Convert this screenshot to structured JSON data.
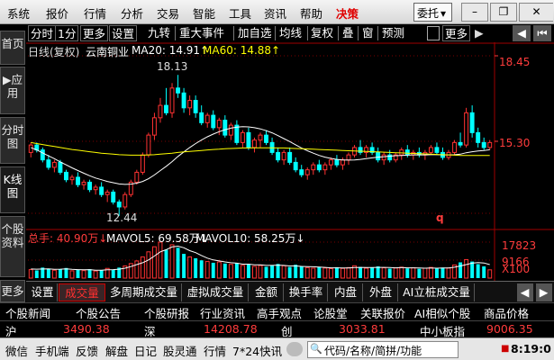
{
  "menu": {
    "items": [
      "系统",
      "报价",
      "行情",
      "分析",
      "交易",
      "智能",
      "工具",
      "资讯",
      "帮助",
      "决策"
    ],
    "active_index": 9,
    "trade_button": "委托",
    "trade_caret": "▾"
  },
  "window_controls": {
    "minimize": "–",
    "restore": "❐",
    "close": "✕"
  },
  "left_tabs": [
    {
      "label": "首页"
    },
    {
      "label": "▶应用"
    },
    {
      "label": "分时图"
    },
    {
      "label": "K线图",
      "active": true
    },
    {
      "label": "个股资料"
    },
    {
      "label": "更多"
    }
  ],
  "toolbar": {
    "items": [
      "分时",
      "1分",
      "更多",
      "设置",
      "九转",
      "重大事件",
      "加自选",
      "均线",
      "复权",
      "叠",
      "窗",
      "预测"
    ],
    "more": "更多",
    "caret": "▶",
    "prev": "◀",
    "skip": "⏮"
  },
  "chart_header": {
    "period": "日线(复权)",
    "name": "云南铜业",
    "ma20_label": "MA20: 14.91",
    "ma60_label": "MA60: 14.88",
    "ma20_arrow": "↑",
    "ma60_arrow": "↑"
  },
  "price_axis": {
    "top": "18.45",
    "mid": "15.30"
  },
  "annotations": {
    "high": "18.13",
    "low": "12.44",
    "marker": "q"
  },
  "volume_header": {
    "total": "总手: 40.90万",
    "total_arrow": "↓",
    "mavol5": "MAVOL5: 69.58万",
    "mavol5_arrow": "↓",
    "mavol10": "MAVOL10: 58.25万",
    "mavol10_arrow": "↓"
  },
  "volume_axis": {
    "top": "17823",
    "mid": "9166",
    "unit": "X100"
  },
  "chart_data": {
    "type": "candlestick",
    "ylim": [
      12.0,
      18.9
    ],
    "candles": [
      [
        15.0,
        15.4,
        14.8,
        15.3
      ],
      [
        15.3,
        15.4,
        15.0,
        15.1
      ],
      [
        15.1,
        15.2,
        14.6,
        14.7
      ],
      [
        14.7,
        14.9,
        14.3,
        14.4
      ],
      [
        14.4,
        14.7,
        14.2,
        14.6
      ],
      [
        14.6,
        14.7,
        14.1,
        14.2
      ],
      [
        14.2,
        14.3,
        13.8,
        13.9
      ],
      [
        13.9,
        14.1,
        13.7,
        14.0
      ],
      [
        14.0,
        14.2,
        13.6,
        13.7
      ],
      [
        13.7,
        13.9,
        13.5,
        13.8
      ],
      [
        13.8,
        13.9,
        13.4,
        13.5
      ],
      [
        13.5,
        13.7,
        13.3,
        13.6
      ],
      [
        13.6,
        13.8,
        13.2,
        13.3
      ],
      [
        13.3,
        13.5,
        13.0,
        13.4
      ],
      [
        13.4,
        13.5,
        12.9,
        13.0
      ],
      [
        13.0,
        13.1,
        12.44,
        12.8
      ],
      [
        12.8,
        13.4,
        12.7,
        13.3
      ],
      [
        13.3,
        13.9,
        13.2,
        13.8
      ],
      [
        13.8,
        14.3,
        13.7,
        14.2
      ],
      [
        14.2,
        15.0,
        14.1,
        14.9
      ],
      [
        14.9,
        15.8,
        14.8,
        15.7
      ],
      [
        15.7,
        16.6,
        15.5,
        16.4
      ],
      [
        16.4,
        17.2,
        16.2,
        16.9
      ],
      [
        16.9,
        17.6,
        16.5,
        16.6
      ],
      [
        16.6,
        17.8,
        16.4,
        17.6
      ],
      [
        17.6,
        18.13,
        17.2,
        17.4
      ],
      [
        17.4,
        17.6,
        16.6,
        16.8
      ],
      [
        16.8,
        17.3,
        16.5,
        17.1
      ],
      [
        17.1,
        17.3,
        16.4,
        16.6
      ],
      [
        16.6,
        16.9,
        16.1,
        16.2
      ],
      [
        16.2,
        16.6,
        16.0,
        16.5
      ],
      [
        16.5,
        16.7,
        15.9,
        16.0
      ],
      [
        16.0,
        16.4,
        15.7,
        16.3
      ],
      [
        16.3,
        16.5,
        15.6,
        15.7
      ],
      [
        15.7,
        16.2,
        15.5,
        16.1
      ],
      [
        16.1,
        16.3,
        15.3,
        15.4
      ],
      [
        15.4,
        15.9,
        15.2,
        15.8
      ],
      [
        15.8,
        16.0,
        15.1,
        15.2
      ],
      [
        15.2,
        15.6,
        15.0,
        15.5
      ],
      [
        15.5,
        15.8,
        15.2,
        15.7
      ],
      [
        15.7,
        15.9,
        15.3,
        15.4
      ],
      [
        15.4,
        15.6,
        14.9,
        15.0
      ],
      [
        15.0,
        15.2,
        14.6,
        14.7
      ],
      [
        14.7,
        15.1,
        14.5,
        15.0
      ],
      [
        15.0,
        15.2,
        14.5,
        14.6
      ],
      [
        14.6,
        14.8,
        14.2,
        14.3
      ],
      [
        14.3,
        14.5,
        14.0,
        14.1
      ],
      [
        14.1,
        14.4,
        13.9,
        14.3
      ],
      [
        14.3,
        14.6,
        14.1,
        14.5
      ],
      [
        14.5,
        14.7,
        14.2,
        14.3
      ],
      [
        14.3,
        14.6,
        14.1,
        14.5
      ],
      [
        14.5,
        14.8,
        14.3,
        14.7
      ],
      [
        14.7,
        14.9,
        14.4,
        14.5
      ],
      [
        14.5,
        14.8,
        14.3,
        14.7
      ],
      [
        14.7,
        15.0,
        14.5,
        14.9
      ],
      [
        14.9,
        15.3,
        14.8,
        15.2
      ],
      [
        15.2,
        15.5,
        14.9,
        15.0
      ],
      [
        15.0,
        15.3,
        14.8,
        15.2
      ],
      [
        15.2,
        15.4,
        14.9,
        15.0
      ],
      [
        15.0,
        15.2,
        14.6,
        14.7
      ],
      [
        14.7,
        15.0,
        14.5,
        14.9
      ],
      [
        14.9,
        15.1,
        14.6,
        14.7
      ],
      [
        14.7,
        15.0,
        14.6,
        14.9
      ],
      [
        14.9,
        15.2,
        14.7,
        15.1
      ],
      [
        15.1,
        15.3,
        14.8,
        14.9
      ],
      [
        14.9,
        15.1,
        14.7,
        15.0
      ],
      [
        15.0,
        15.2,
        14.8,
        14.9
      ],
      [
        14.9,
        15.1,
        14.7,
        15.0
      ],
      [
        15.0,
        15.3,
        14.9,
        15.2
      ],
      [
        15.2,
        15.4,
        14.9,
        15.0
      ],
      [
        15.0,
        15.2,
        14.7,
        14.8
      ],
      [
        14.8,
        15.1,
        14.7,
        15.0
      ],
      [
        15.0,
        15.5,
        14.9,
        15.4
      ],
      [
        15.4,
        15.8,
        15.2,
        15.3
      ],
      [
        15.3,
        16.8,
        15.2,
        16.6
      ],
      [
        16.6,
        16.9,
        15.6,
        15.8
      ],
      [
        15.8,
        16.0,
        15.2,
        15.4
      ],
      [
        15.4,
        15.6,
        15.1,
        15.2
      ],
      [
        15.2,
        15.5,
        15.1,
        15.4
      ]
    ],
    "volume_axis_top": 17823,
    "volumes": [
      4200,
      3800,
      5200,
      4600,
      3900,
      4300,
      5000,
      3600,
      4100,
      3700,
      4400,
      3500,
      3900,
      4800,
      4200,
      5200,
      6000,
      7200,
      8500,
      10500,
      13000,
      15500,
      17823,
      14000,
      16500,
      15000,
      12000,
      10500,
      9800,
      8800,
      8200,
      7600,
      8000,
      7200,
      6800,
      7400,
      6300,
      6900,
      5800,
      6200,
      5600,
      6400,
      7000,
      6100,
      5500,
      6600,
      5900,
      5200,
      4900,
      5600,
      5000,
      4700,
      5400,
      4800,
      5200,
      6100,
      5500,
      4900,
      5300,
      5800,
      5100,
      4700,
      5000,
      5400,
      4800,
      5100,
      4600,
      4900,
      5300,
      4700,
      5200,
      5000,
      6500,
      7800,
      9166,
      8200,
      6900,
      5800,
      4090
    ],
    "ma20": [
      15.2,
      15.1,
      14.98,
      14.86,
      14.75,
      14.62,
      14.5,
      14.38,
      14.27,
      14.16,
      14.06,
      13.97,
      13.9,
      13.83,
      13.78,
      13.73,
      13.71,
      13.72,
      13.76,
      13.83,
      13.94,
      14.09,
      14.27,
      14.44,
      14.63,
      14.84,
      15.02,
      15.2,
      15.36,
      15.5,
      15.63,
      15.74,
      15.84,
      15.92,
      15.98,
      16.02,
      16.04,
      16.03,
      16.0,
      15.95,
      15.88,
      15.79,
      15.68,
      15.56,
      15.44,
      15.31,
      15.18,
      15.07,
      14.97,
      14.88,
      14.81,
      14.76,
      14.72,
      14.7,
      14.69,
      14.7,
      14.72,
      14.75,
      14.78,
      14.81,
      14.83,
      14.85,
      14.87,
      14.88,
      14.89,
      14.9,
      14.9,
      14.9,
      14.91,
      14.91,
      14.9,
      14.9,
      14.91,
      14.93,
      14.99,
      15.03,
      15.06,
      15.08,
      15.11
    ],
    "ma60": [
      15.4,
      15.36,
      15.32,
      15.28,
      15.24,
      15.2,
      15.16,
      15.12,
      15.09,
      15.06,
      15.03,
      15.0,
      14.97,
      14.95,
      14.93,
      14.91,
      14.9,
      14.89,
      14.89,
      14.89,
      14.9,
      14.91,
      14.93,
      14.95,
      14.97,
      15.0,
      15.02,
      15.04,
      15.06,
      15.08,
      15.1,
      15.12,
      15.13,
      15.15,
      15.16,
      15.17,
      15.18,
      15.18,
      15.19,
      15.19,
      15.19,
      15.19,
      15.18,
      15.18,
      15.17,
      15.16,
      15.15,
      15.14,
      15.13,
      15.12,
      15.11,
      15.1,
      15.09,
      15.08,
      15.07,
      15.06,
      15.05,
      15.04,
      15.03,
      15.02,
      15.01,
      15.0,
      14.99,
      14.98,
      14.97,
      14.96,
      14.95,
      14.94,
      14.93,
      14.92,
      14.91,
      14.9,
      14.89,
      14.88,
      14.88,
      14.88,
      14.88,
      14.88,
      14.88
    ],
    "mavol5": [
      4500,
      4400,
      4500,
      4600,
      4300,
      4400,
      4600,
      4300,
      4200,
      4100,
      4200,
      3900,
      3900,
      4100,
      4200,
      4400,
      4900,
      5700,
      6700,
      7600,
      9000,
      10900,
      13000,
      14100,
      15400,
      15800,
      15000,
      13600,
      12600,
      11200,
      9900,
      9000,
      8500,
      8000,
      7600,
      7400,
      6900,
      6900,
      6600,
      6600,
      6300,
      6300,
      6400,
      6300,
      6000,
      6000,
      5800,
      5700,
      5600,
      5500,
      5300,
      5100,
      5100,
      5000,
      5000,
      5200,
      5300,
      5200,
      5200,
      5300,
      5300,
      5200,
      5100,
      5200,
      5100,
      5100,
      5000,
      4900,
      5000,
      4900,
      5000,
      5000,
      5400,
      6000,
      6700,
      7400,
      7700,
      7500,
      6700
    ],
    "colors": {
      "up": "#ff3232",
      "down": "#00ffff",
      "ma20": "#ffffff",
      "ma60": "#ffff00",
      "mavol5": "#ffffff"
    }
  },
  "bottom_tabs": [
    "设置",
    "成交量",
    "多周期成交量",
    "虚拟成交量",
    "金额",
    "换手率",
    "内盘",
    "外盘",
    "AI立桩成交量"
  ],
  "bottom_tabs_active": 1,
  "bottom_nav": {
    "prev": "◀",
    "next": "▶"
  },
  "links": [
    "个股新闻",
    "个股公告",
    "个股研报",
    "行业资讯",
    "高手观点",
    "论股堂",
    "关联报价",
    "AI相似个股",
    "商品价格"
  ],
  "indices": [
    {
      "name": "沪",
      "value": "3490.38"
    },
    {
      "name": "深",
      "value": "14208.78"
    },
    {
      "name": "创",
      "value": "3033.81"
    },
    {
      "name": "中小板指",
      "value": "9006.35"
    }
  ],
  "status_bar": {
    "items": [
      "微信",
      "手机端",
      "反馈",
      "解盘",
      "日记",
      "股灵通",
      "行情",
      "7*24快讯"
    ],
    "search_placeholder": "代码/名称/简拼/功能",
    "search_icon": "🔍",
    "time": "8:19:0",
    "clock_icon": "■"
  }
}
